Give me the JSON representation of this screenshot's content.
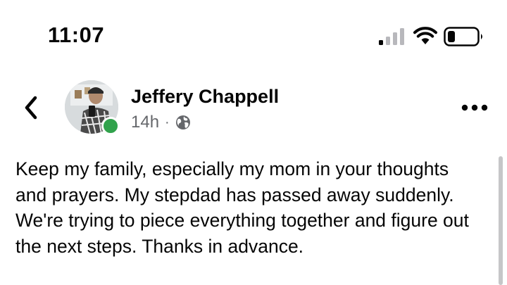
{
  "status_bar": {
    "time": "11:07",
    "icons": [
      "cellular-signal-icon",
      "wifi-icon",
      "battery-icon"
    ]
  },
  "post": {
    "author": "Jeffery Chappell",
    "time_ago": "14h",
    "separator": "·",
    "audience_icon": "globe-icon",
    "online": true,
    "text": "Keep my family, especially my mom in your thoughts and prayers. My stepdad has passed away suddenly. We're trying to piece everything together and figure out the next steps. Thanks in advance."
  },
  "colors": {
    "text_primary": "#050505",
    "text_secondary": "#65676b",
    "online_green": "#31a24c",
    "scrollbar": "#c6c6c8"
  }
}
